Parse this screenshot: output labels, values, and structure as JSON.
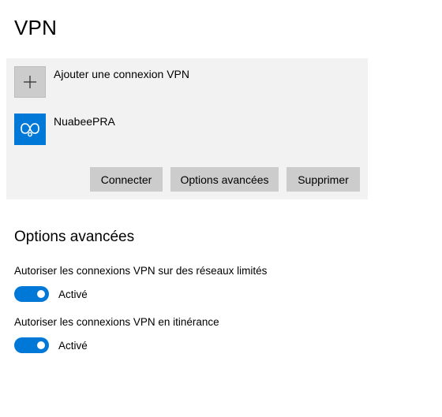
{
  "page": {
    "title": "VPN"
  },
  "vpn_list": {
    "add_label": "Ajouter une connexion VPN",
    "add_icon": "plus-icon",
    "connections": [
      {
        "name": "NuabeePRA",
        "icon": "vpn-connection-icon"
      }
    ],
    "buttons": {
      "connect": "Connecter",
      "advanced": "Options avancées",
      "remove": "Supprimer"
    }
  },
  "advanced_options": {
    "title": "Options avancées",
    "settings": [
      {
        "label": "Autoriser les connexions VPN sur des réseaux limités",
        "state": "Activé",
        "enabled": true
      },
      {
        "label": "Autoriser les connexions VPN en itinérance",
        "state": "Activé",
        "enabled": true
      }
    ]
  },
  "colors": {
    "accent": "#0078d7",
    "panel_bg": "#f2f2f2",
    "button_bg": "#cccccc"
  }
}
